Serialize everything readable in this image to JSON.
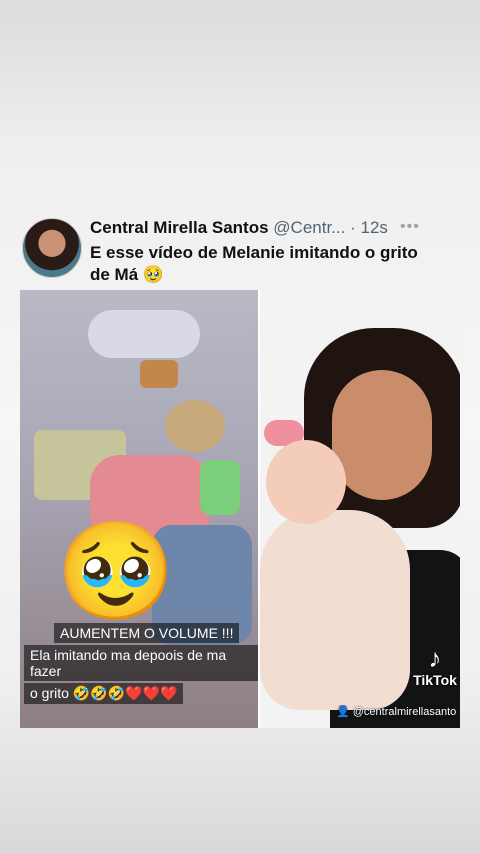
{
  "tweet": {
    "display_name": "Central Mirella Santos",
    "handle": "@Centr...",
    "separator": "·",
    "time": "12s",
    "more_icon": "more-horizontal-icon",
    "text_line1": "E esse vídeo de Melanie imitando o grito",
    "text_line2": "de Má",
    "text_emoji": "🥹"
  },
  "media": {
    "left": {
      "emoji": "🥹",
      "caption_line1": "AUMENTEM O VOLUME !!!",
      "caption_line2": "Ela imitando ma depoois de ma fazer",
      "caption_line3": "o grito 🤣🤣🤣❤️❤️❤️"
    },
    "right": {
      "tiktok_logo": "♪",
      "tiktok_label": "TikTok",
      "credit": "@centralmirellasanto"
    }
  },
  "colors": {
    "name_text": "#111111",
    "secondary_text": "#536471",
    "caption_bg": "#000000"
  }
}
